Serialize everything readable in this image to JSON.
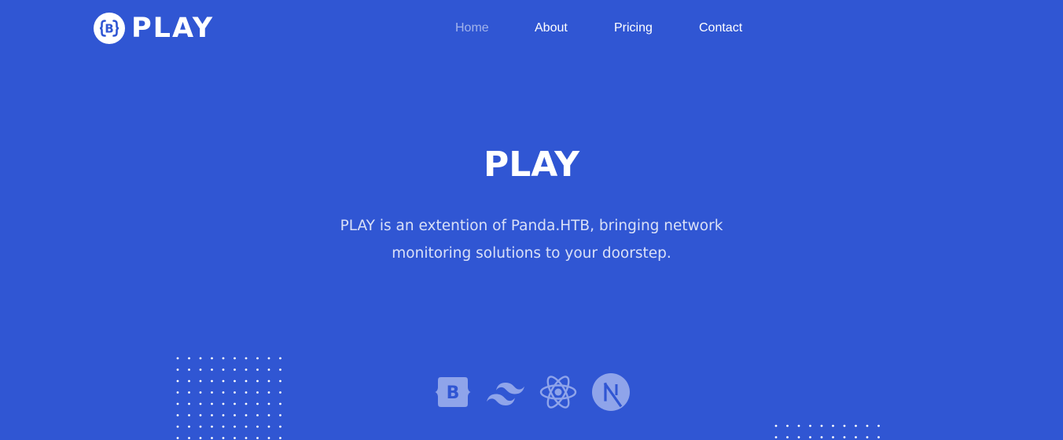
{
  "brand": {
    "logo_letter": "B",
    "name": "PLAY",
    "logo_icon": "bootstrap-logo-icon"
  },
  "nav": {
    "items": [
      {
        "label": "Home",
        "active": true
      },
      {
        "label": "About",
        "active": false
      },
      {
        "label": "Pricing",
        "active": false
      },
      {
        "label": "Contact",
        "active": false
      }
    ]
  },
  "hero": {
    "title": "PLAY",
    "description": "PLAY is an extention of Panda.HTB, bringing network monitoring solutions to your doorstep."
  },
  "tech_icons": [
    {
      "name": "bootstrap-icon",
      "letter": "B"
    },
    {
      "name": "tailwind-icon"
    },
    {
      "name": "react-icon"
    },
    {
      "name": "nextjs-icon",
      "letter": "N"
    }
  ],
  "colors": {
    "background": "#3056d3",
    "text": "#ffffff",
    "nav_active": "rgba(255,255,255,0.55)",
    "icon_fill": "#8fa4ea"
  }
}
